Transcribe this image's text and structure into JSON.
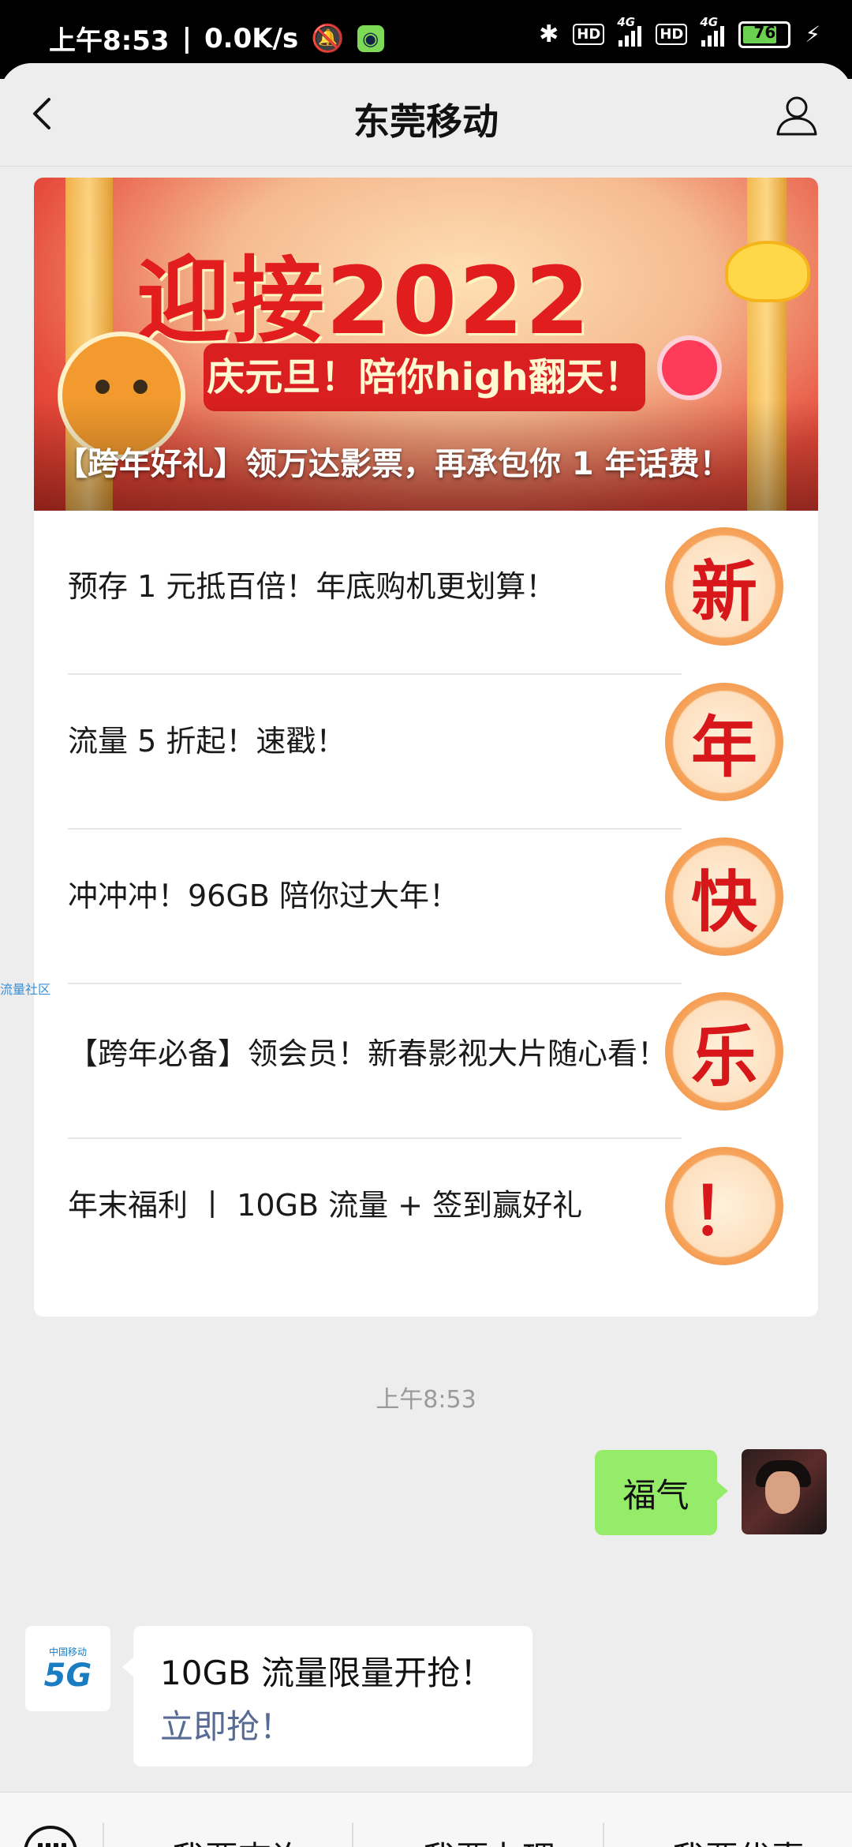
{
  "status_bar": {
    "time": "上午8:53",
    "speed": "0.0K/s",
    "hd1": "HD",
    "net1": "4G",
    "hd2": "HD",
    "net2": "4G",
    "battery": "76"
  },
  "header": {
    "title": "东莞移动"
  },
  "article": {
    "banner_headline": "迎接2022",
    "banner_ribbon": "庆元旦！陪你high翻天！",
    "banner_caption": "【跨年好礼】领万达影票，再承包你 1 年话费！",
    "items": [
      {
        "text": "预存 1 元抵百倍！年底购机更划算！",
        "badge": "新"
      },
      {
        "text": "流量 5 折起！速戳！",
        "badge": "年"
      },
      {
        "text": "冲冲冲！96GB 陪你过大年！",
        "badge": "快"
      },
      {
        "text": "【跨年必备】领会员！新春影视大片随心看！",
        "badge": "乐"
      },
      {
        "text": "年末福利 丨 10GB 流量 + 签到赢好礼",
        "badge": "！"
      }
    ]
  },
  "side_tag": "流量社区",
  "chat": {
    "timestamp": "上午8:53",
    "my_message": "福气",
    "bot_logo_text": "中国移动",
    "bot_logo_5g": "5G",
    "bot_message": "10GB 流量限量开抢！",
    "bot_link": "立即抢！"
  },
  "bottom_menu": {
    "items": [
      "我要查询",
      "我要办理",
      "我要优惠"
    ]
  },
  "colors": {
    "my_bubble": "#95ec69",
    "link": "#576b95",
    "badge_text": "#d8171b"
  }
}
